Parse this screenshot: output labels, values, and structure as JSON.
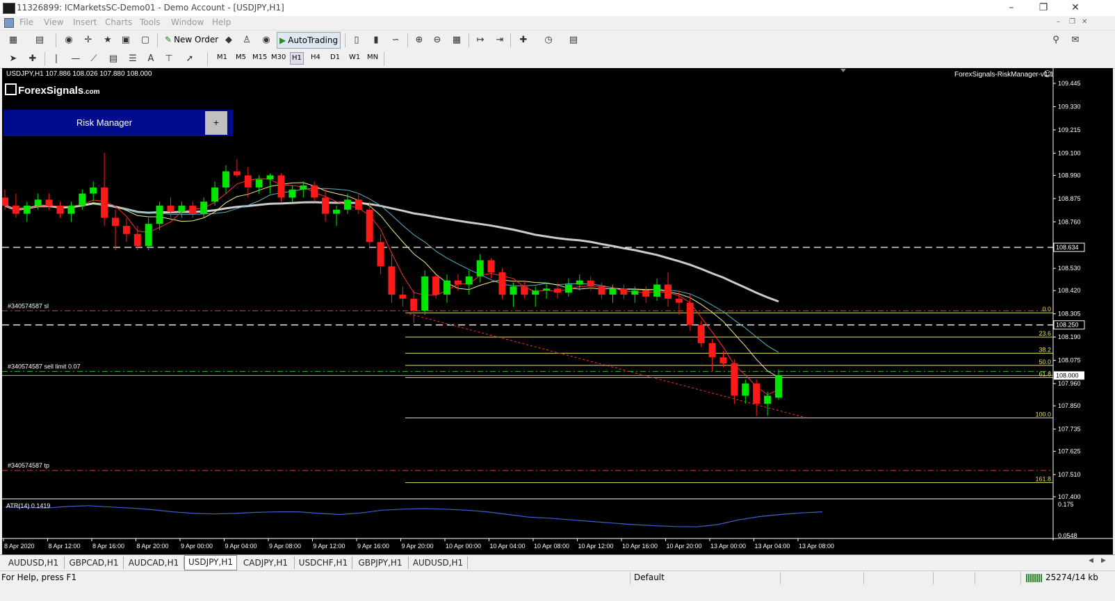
{
  "window": {
    "title": "11326899: ICMarketsSC-Demo01 - Demo Account - [USDJPY,H1]",
    "minimize_icon": "minimize-icon",
    "restore_icon": "restore-icon",
    "close_icon": "close-icon"
  },
  "menu": [
    "File",
    "View",
    "Insert",
    "Charts",
    "Tools",
    "Window",
    "Help"
  ],
  "toolbar": {
    "new_order_label": "New Order",
    "autotrading_label": "AutoTrading",
    "timeframes": [
      "M1",
      "M5",
      "M15",
      "M30",
      "H1",
      "H4",
      "D1",
      "W1",
      "MN"
    ],
    "active_timeframe": "H1",
    "text_tool_label": "A"
  },
  "chart_data": {
    "type": "candlestick",
    "header": "USDJPY,H1  107.886 108.026 107.880 108.000",
    "indicator_label": "ForexSignals-RiskManager-v1.1",
    "logo_text": "ForexSignals",
    "logo_suffix": ".com",
    "risk_manager_button": "Risk Manager",
    "risk_manager_plus": "+",
    "ylim": [
      107.4,
      109.5
    ],
    "price_ticks": [
      109.445,
      109.33,
      109.215,
      109.1,
      108.99,
      108.875,
      108.76,
      108.53,
      108.42,
      108.305,
      108.19,
      108.075,
      107.96,
      107.85,
      107.735,
      107.625,
      107.51,
      107.4
    ],
    "current_price": "108.000",
    "hline_labels": [
      {
        "price": 108.634,
        "label": "108.634"
      },
      {
        "price": 108.25,
        "label": "108.250"
      }
    ],
    "order_lines": [
      {
        "name": "#340574587 sl",
        "price": 108.32
      },
      {
        "name": "#340574587 sell limit 0.07",
        "price": 108.02
      },
      {
        "name": "#340574587 tp",
        "price": 107.53
      }
    ],
    "fibonacci": [
      {
        "level": "0.0",
        "price": 108.31
      },
      {
        "level": "23.6",
        "price": 108.19
      },
      {
        "level": "38.2",
        "price": 108.11
      },
      {
        "level": "50.0",
        "price": 108.05
      },
      {
        "level": "61.8",
        "price": 107.99
      },
      {
        "level": "100.0",
        "price": 107.79
      },
      {
        "level": "161.8",
        "price": 107.47
      }
    ],
    "time_labels": [
      "8 Apr 2020",
      "8 Apr 12:00",
      "8 Apr 16:00",
      "8 Apr 20:00",
      "9 Apr 00:00",
      "9 Apr 04:00",
      "9 Apr 08:00",
      "9 Apr 12:00",
      "9 Apr 16:00",
      "9 Apr 20:00",
      "10 Apr 00:00",
      "10 Apr 04:00",
      "10 Apr 08:00",
      "10 Apr 12:00",
      "10 Apr 16:00",
      "10 Apr 20:00",
      "13 Apr 00:00",
      "13 Apr 04:00",
      "13 Apr 08:00"
    ],
    "candles": [
      [
        108.88,
        108.92,
        108.82,
        108.84
      ],
      [
        108.84,
        108.9,
        108.78,
        108.8
      ],
      [
        108.8,
        108.86,
        108.76,
        108.84
      ],
      [
        108.84,
        108.9,
        108.82,
        108.87
      ],
      [
        108.87,
        108.9,
        108.82,
        108.84
      ],
      [
        108.84,
        108.86,
        108.78,
        108.8
      ],
      [
        108.8,
        108.86,
        108.76,
        108.84
      ],
      [
        108.84,
        108.92,
        108.82,
        108.9
      ],
      [
        108.9,
        108.96,
        108.86,
        108.93
      ],
      [
        108.93,
        109.1,
        108.74,
        108.78
      ],
      [
        108.78,
        108.82,
        108.62,
        108.74
      ],
      [
        108.74,
        108.78,
        108.66,
        108.7
      ],
      [
        108.7,
        108.74,
        108.62,
        108.64
      ],
      [
        108.64,
        108.78,
        108.62,
        108.75
      ],
      [
        108.75,
        108.86,
        108.72,
        108.84
      ],
      [
        108.84,
        108.88,
        108.78,
        108.81
      ],
      [
        108.81,
        108.86,
        108.78,
        108.84
      ],
      [
        108.84,
        108.86,
        108.78,
        108.8
      ],
      [
        108.8,
        108.88,
        108.78,
        108.86
      ],
      [
        108.86,
        108.96,
        108.84,
        108.93
      ],
      [
        108.93,
        109.04,
        108.9,
        109.01
      ],
      [
        109.01,
        109.07,
        108.98,
        108.99
      ],
      [
        108.99,
        109.03,
        108.88,
        108.93
      ],
      [
        108.93,
        108.99,
        108.9,
        108.97
      ],
      [
        108.97,
        109.0,
        108.9,
        108.99
      ],
      [
        108.99,
        109.0,
        108.86,
        108.88
      ],
      [
        108.88,
        108.94,
        108.86,
        108.92
      ],
      [
        108.92,
        108.96,
        108.88,
        108.94
      ],
      [
        108.94,
        108.96,
        108.86,
        108.88
      ],
      [
        108.88,
        108.92,
        108.76,
        108.8
      ],
      [
        108.8,
        108.84,
        108.74,
        108.82
      ],
      [
        108.82,
        108.9,
        108.8,
        108.87
      ],
      [
        108.87,
        108.9,
        108.8,
        108.82
      ],
      [
        108.82,
        108.86,
        108.64,
        108.66
      ],
      [
        108.66,
        108.7,
        108.5,
        108.54
      ],
      [
        108.54,
        108.6,
        108.36,
        108.4
      ],
      [
        108.4,
        108.44,
        108.34,
        108.38
      ],
      [
        108.38,
        108.42,
        108.26,
        108.32
      ],
      [
        108.32,
        108.52,
        108.3,
        108.49
      ],
      [
        108.49,
        108.5,
        108.38,
        108.4
      ],
      [
        108.4,
        108.5,
        108.36,
        108.47
      ],
      [
        108.47,
        108.5,
        108.42,
        108.45
      ],
      [
        108.45,
        108.52,
        108.4,
        108.49
      ],
      [
        108.49,
        108.6,
        108.46,
        108.57
      ],
      [
        108.57,
        108.58,
        108.48,
        108.51
      ],
      [
        108.51,
        108.53,
        108.38,
        108.4
      ],
      [
        108.4,
        108.46,
        108.34,
        108.44
      ],
      [
        108.44,
        108.47,
        108.38,
        108.4
      ],
      [
        108.4,
        108.44,
        108.34,
        108.42
      ],
      [
        108.42,
        108.46,
        108.38,
        108.43
      ],
      [
        108.43,
        108.46,
        108.38,
        108.41
      ],
      [
        108.41,
        108.48,
        108.39,
        108.45
      ],
      [
        108.45,
        108.5,
        108.42,
        108.47
      ],
      [
        108.47,
        108.49,
        108.42,
        108.44
      ],
      [
        108.44,
        108.46,
        108.38,
        108.4
      ],
      [
        108.4,
        108.45,
        108.36,
        108.43
      ],
      [
        108.43,
        108.45,
        108.38,
        108.4
      ],
      [
        108.4,
        108.44,
        108.36,
        108.42
      ],
      [
        108.42,
        108.44,
        108.36,
        108.39
      ],
      [
        108.39,
        108.48,
        108.37,
        108.45
      ],
      [
        108.45,
        108.51,
        108.34,
        108.38
      ],
      [
        108.38,
        108.42,
        108.3,
        108.36
      ],
      [
        108.36,
        108.4,
        108.22,
        108.25
      ],
      [
        108.25,
        108.27,
        108.14,
        108.16
      ],
      [
        108.16,
        108.18,
        108.02,
        108.09
      ],
      [
        108.09,
        108.12,
        108.04,
        108.06
      ],
      [
        108.06,
        108.08,
        107.86,
        107.9
      ],
      [
        107.9,
        107.98,
        107.86,
        107.96
      ],
      [
        107.96,
        107.98,
        107.8,
        107.86
      ],
      [
        107.86,
        107.92,
        107.8,
        107.9
      ],
      [
        107.89,
        108.03,
        107.88,
        108.0
      ]
    ],
    "atr": {
      "label": "ATR(14) 0.1419",
      "scale_top": "0.175",
      "scale_bottom": "0.0548",
      "values": [
        0.16,
        0.158,
        0.156,
        0.162,
        0.165,
        0.16,
        0.156,
        0.15,
        0.142,
        0.136,
        0.134,
        0.136,
        0.14,
        0.142,
        0.142,
        0.136,
        0.132,
        0.138,
        0.148,
        0.152,
        0.154,
        0.152,
        0.148,
        0.142,
        0.132,
        0.122,
        0.118,
        0.112,
        0.106,
        0.1,
        0.094,
        0.09,
        0.087,
        0.086,
        0.094,
        0.112,
        0.124,
        0.132,
        0.138,
        0.142
      ]
    }
  },
  "colors": {
    "bull": "#00e600",
    "bear": "#ff1a1a",
    "fib": "#e8e060",
    "ma_red": "#ff3030",
    "ma_yellow": "#f0f090",
    "ma_cyan": "#5ab4c8",
    "ma_white": "#cccccc",
    "atr": "#4060d0",
    "risk_button": "#000c8c"
  },
  "tabs": [
    "AUDUSD,H1",
    "GBPCAD,H1",
    "AUDCAD,H1",
    "USDJPY,H1",
    "CADJPY,H1",
    "USDCHF,H1",
    "GBPJPY,H1",
    "AUDUSD,H1"
  ],
  "active_tab": "USDJPY,H1",
  "status": {
    "help": "For Help, press F1",
    "profile": "Default",
    "traffic": "25274/14 kb"
  }
}
